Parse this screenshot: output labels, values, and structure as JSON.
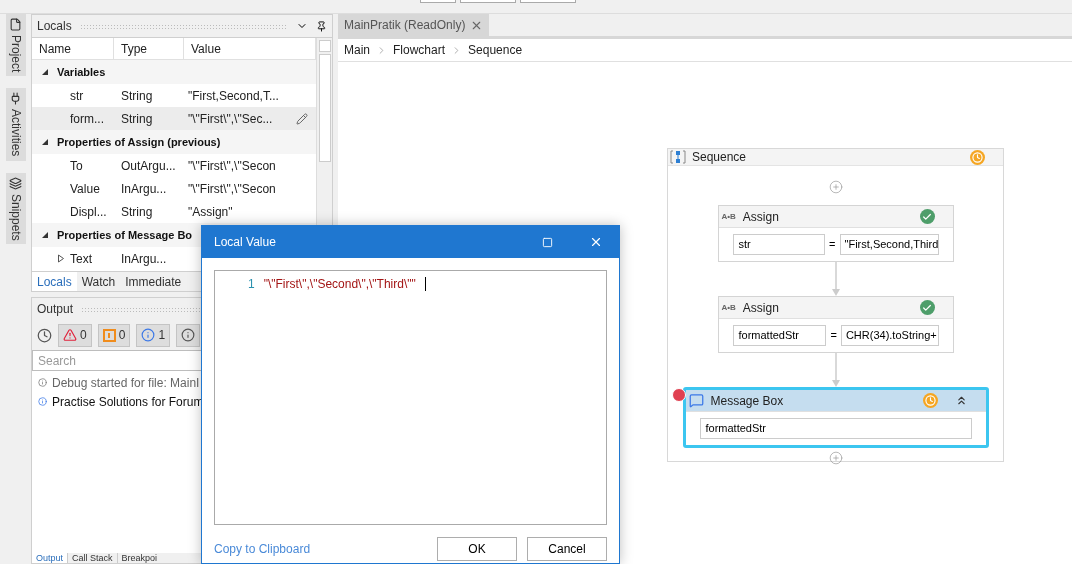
{
  "sidebar_tabs": [
    {
      "label": "Project",
      "kind": "file"
    },
    {
      "label": "Activities",
      "kind": "activities"
    },
    {
      "label": "Snippets",
      "kind": "snippets"
    }
  ],
  "locals": {
    "title": "Locals",
    "columns": [
      "Name",
      "Type",
      "Value"
    ],
    "groups": [
      {
        "label": "Variables",
        "expanded": true,
        "rows": [
          {
            "name": "str",
            "type": "String",
            "value": "\"First,Second,T...",
            "selected": false
          },
          {
            "name": "form...",
            "type": "String",
            "value": "\"\\\"First\\\",\\\"Sec...",
            "selected": true
          }
        ]
      },
      {
        "label": "Properties of Assign (previous)",
        "expanded": true,
        "rows": [
          {
            "name": "To",
            "type": "OutArgu...",
            "value": "\"\\\"First\\\",\\\"Secon",
            "selected": false
          },
          {
            "name": "Value",
            "type": "InArgu...",
            "value": "\"\\\"First\\\",\\\"Secon",
            "selected": false
          },
          {
            "name": "Displ...",
            "type": "String",
            "value": "\"Assign\"",
            "selected": false
          }
        ]
      },
      {
        "label": "Properties of Message Bo",
        "expanded": true,
        "rows": [
          {
            "name": "Text",
            "type": "InArgu...",
            "selected": false,
            "expanded": false
          }
        ]
      }
    ],
    "tabs": [
      {
        "label": "Locals",
        "selected": true
      },
      {
        "label": "Watch",
        "selected": false
      },
      {
        "label": "Immediate",
        "selected": false
      }
    ]
  },
  "output": {
    "title": "Output",
    "filters": [
      {
        "kind": "error",
        "count": "0"
      },
      {
        "kind": "warning",
        "count": "0"
      },
      {
        "kind": "info",
        "count": "1"
      },
      {
        "kind": "trace"
      }
    ],
    "search": {
      "placeholder": "Search"
    },
    "lines": [
      {
        "kind": "trace",
        "text": "Debug started for file: MainI"
      },
      {
        "kind": "info",
        "text": "Practise Solutions for Forum"
      }
    ],
    "tabs": [
      {
        "label": "Output",
        "selected": true
      },
      {
        "label": "Call Stack",
        "selected": false
      },
      {
        "label": "Breakpoi",
        "selected": false
      }
    ]
  },
  "document_tab": {
    "title": "MainPratik (ReadOnly)"
  },
  "breadcrumb": [
    "Main",
    "Flowchart",
    "Sequence"
  ],
  "sequence": {
    "title": "Sequence",
    "completed": false,
    "activities": [
      {
        "kind": "assign",
        "badge": "A•B",
        "title": "Assign",
        "completed": true,
        "selected": false,
        "breakpoint": false,
        "to": "str",
        "operator": "=",
        "value": "\"First,Second,Third"
      },
      {
        "kind": "assign",
        "badge": "A•B",
        "title": "Assign",
        "completed": true,
        "selected": false,
        "breakpoint": false,
        "to": "formattedStr",
        "operator": "=",
        "value": "CHR(34).toString+"
      },
      {
        "kind": "message",
        "title": "Message Box",
        "completed": false,
        "selected": true,
        "breakpoint": true,
        "text": "formattedStr"
      }
    ]
  },
  "dialog": {
    "title": "Local Value",
    "lines": [
      {
        "number": "1",
        "text": "\"\\\"First\\\",\\\"Second\\\",\\\"Third\\\"\""
      }
    ],
    "link": "Copy to Clipboard",
    "buttons": [
      "OK",
      "Cancel"
    ]
  }
}
